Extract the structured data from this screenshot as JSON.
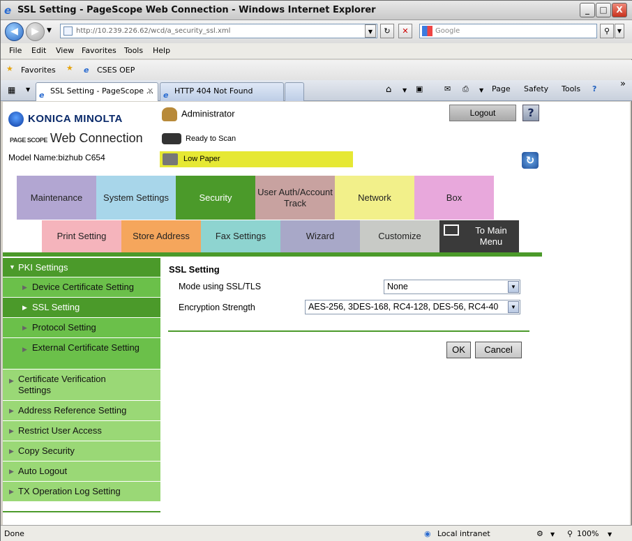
{
  "window": {
    "title": "SSL Setting - PageScope Web Connection - Windows Internet Explorer",
    "controls": [
      "_",
      "□",
      "X"
    ]
  },
  "address_bar": {
    "url": "http://10.239.226.62/wcd/a_security_ssl.xml",
    "search_placeholder": "Google"
  },
  "menu": [
    "File",
    "Edit",
    "View",
    "Favorites",
    "Tools",
    "Help"
  ],
  "favorites_bar": {
    "favorites_label": "Favorites",
    "link": "CSES OEP"
  },
  "tabs": [
    {
      "label": "SSL Setting - PageScope ...",
      "active": true
    },
    {
      "label": "HTTP 404 Not Found",
      "active": false
    }
  ],
  "command_bar": {
    "page": "Page",
    "safety": "Safety",
    "tools": "Tools",
    "more": "»"
  },
  "header": {
    "brand": "KONICA MINOLTA",
    "product_small": "PAGE SCOPE",
    "product": "Web Connection",
    "model": "Model Name:bizhub C654",
    "user": "Administrator",
    "status_ready": "Ready to Scan",
    "status_warning": "Low Paper",
    "logout": "Logout",
    "help": "?"
  },
  "main_tabs": [
    {
      "label": "Maintenance",
      "color": "#b2a6d2"
    },
    {
      "label": "System Settings",
      "color": "#a8d6ea"
    },
    {
      "label": "Security",
      "color": "#4b9a2a"
    },
    {
      "label": "User Auth/Account Track",
      "color": "#c8a2a0"
    },
    {
      "label": "Network",
      "color": "#f2f08a"
    },
    {
      "label": "Box",
      "color": "#e8a8dc"
    }
  ],
  "sub_tabs": [
    {
      "label": "Print Setting",
      "color": "#f5b4bc"
    },
    {
      "label": "Store Address",
      "color": "#f5a65c"
    },
    {
      "label": "Fax Settings",
      "color": "#8ed4d0"
    },
    {
      "label": "Wizard",
      "color": "#a8a8c8"
    },
    {
      "label": "Customize",
      "color": "#c8cac6"
    },
    {
      "label": "To Main Menu",
      "color": "#3a3a3a"
    }
  ],
  "sidebar": {
    "section": "PKI Settings",
    "items": [
      {
        "label": "Device Certificate Setting"
      },
      {
        "label": "SSL Setting",
        "selected": true
      },
      {
        "label": "Protocol Setting"
      },
      {
        "label": "External Certificate Setting"
      },
      {
        "label": "Certificate Verification Settings"
      },
      {
        "label": "Address Reference Setting"
      },
      {
        "label": "Restrict User Access"
      },
      {
        "label": "Copy Security"
      },
      {
        "label": "Auto Logout"
      },
      {
        "label": "TX Operation Log Setting"
      }
    ]
  },
  "content": {
    "title": "SSL Setting",
    "mode_label": "Mode using SSL/TLS",
    "mode_value": "None",
    "strength_label": "Encryption Strength",
    "strength_value": "AES-256, 3DES-168, RC4-128, DES-56, RC4-40",
    "ok": "OK",
    "cancel": "Cancel"
  },
  "status_bar": {
    "left": "Done",
    "zone": "Local intranet",
    "zoom": "100%"
  }
}
